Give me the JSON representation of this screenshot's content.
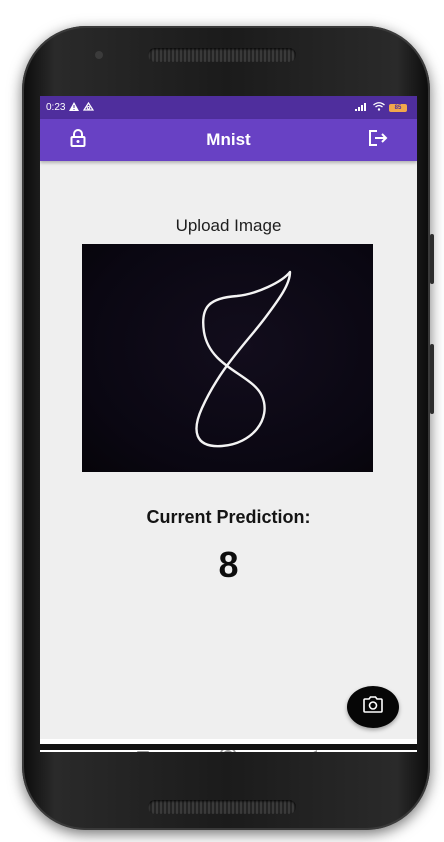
{
  "statusbar": {
    "time": "0:23",
    "battery": "85"
  },
  "appbar": {
    "title": "Mnist",
    "left_icon": "lock-icon",
    "right_icon": "logout-icon"
  },
  "main": {
    "upload_label": "Upload Image",
    "prediction_label": "Current Prediction:",
    "prediction_value": "8"
  },
  "fab": {
    "icon": "camera-icon"
  },
  "navbar": {
    "items": [
      "recents-icon",
      "home-icon",
      "back-icon"
    ]
  },
  "colors": {
    "statusbar": "#4f2e9d",
    "appbar": "#6841c4",
    "screen_bg": "#efefef",
    "fab_bg": "#060606"
  }
}
